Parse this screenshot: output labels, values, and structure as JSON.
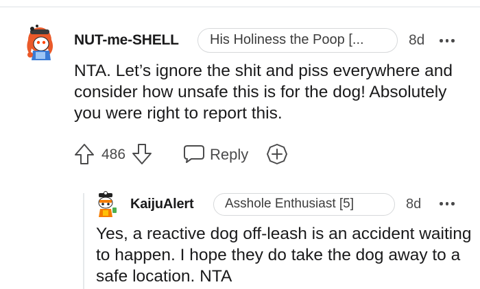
{
  "comments": [
    {
      "username": "NUT-me-SHELL",
      "flair": "His Holiness the Poop [...",
      "age": "8d",
      "body": "NTA. Let’s ignore the shit and piss everywhere and consider how unsafe this is for the dog! Absolutely you were right to report this.",
      "votes": "486",
      "reply_label": "Reply",
      "icons": [
        "avatar",
        "upvote-arrow-icon",
        "downvote-arrow-icon",
        "reply-bubble-icon",
        "award-icon",
        "more-icon"
      ]
    },
    {
      "username": "KaijuAlert",
      "flair": "Asshole Enthusiast [5]",
      "age": "8d",
      "body": "Yes, a reactive dog off-leash is an accident waiting to happen. I hope they do take the dog away to a safe location. NTA",
      "icons": [
        "avatar",
        "more-icon"
      ]
    }
  ],
  "colors": {
    "text": "#1a1a1b",
    "meta": "#4a4a4b",
    "flair_border": "#d6d8da",
    "thread_line": "#e6e8ea"
  }
}
